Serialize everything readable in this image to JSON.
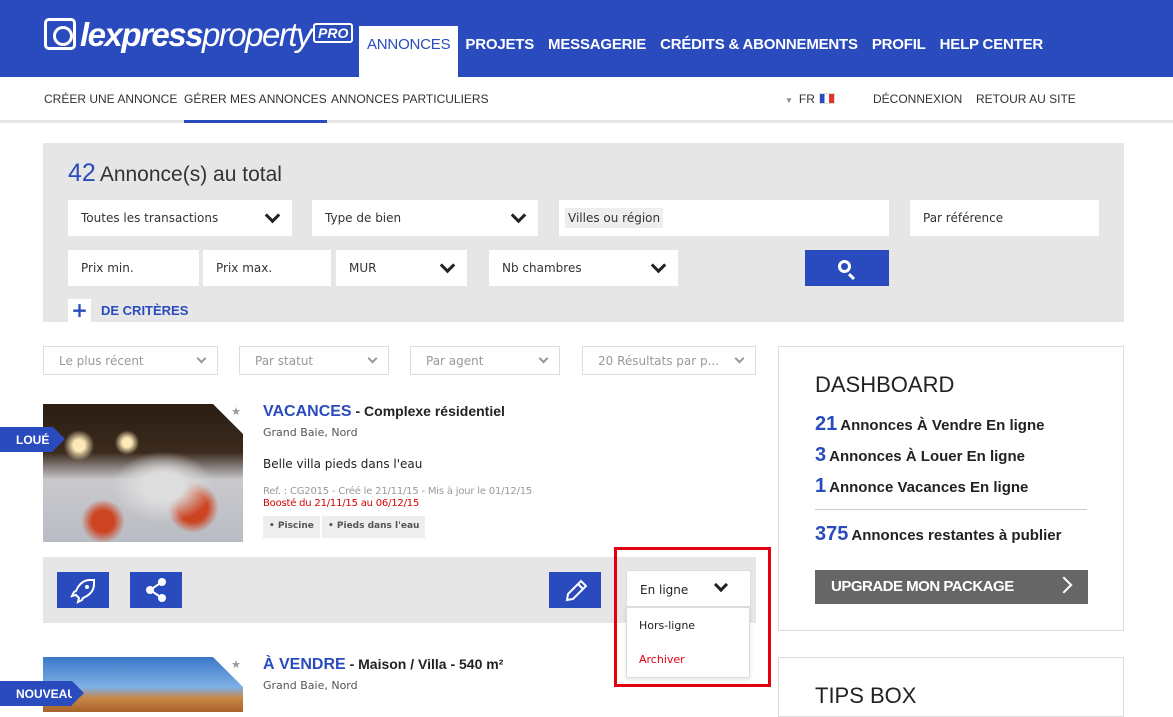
{
  "brand": {
    "name_bold": "lexpress",
    "name_light": "property",
    "badge": "PRO"
  },
  "main_nav": [
    "ANNONCES",
    "PROJETS",
    "MESSAGERIE",
    "CRÉDITS & ABONNEMENTS",
    "PROFIL",
    "HELP CENTER"
  ],
  "sub_nav": {
    "create": "CRÉER UNE ANNONCE",
    "manage": "GÉRER MES ANNONCES",
    "particuliers": "ANNONCES PARTICULIERS",
    "lang": "FR",
    "logout": "DÉCONNEXION",
    "back": "RETOUR AU SITE"
  },
  "search": {
    "total_count": "42",
    "total_label": "Annonce(s) au total",
    "transactions": "Toutes les transactions",
    "type": "Type de bien",
    "ville": "Villes ou région",
    "reference": "Par référence",
    "prix_min": "Prix min.",
    "prix_max": "Prix max.",
    "currency": "MUR",
    "chambres": "Nb chambres",
    "more_criteria": "DE CRITÈRES"
  },
  "filters": {
    "sort": "Le plus récent",
    "status": "Par statut",
    "agent": "Par agent",
    "per_page": "20 Résultats par p..."
  },
  "listings": [
    {
      "badge": "LOUÉ",
      "category": "VACANCES",
      "title": " - Complexe résidentiel",
      "location": "Grand Baie, Nord",
      "description": "Belle villa pieds dans l'eau",
      "meta": "Ref. : CG2015 - Créé le 21/11/15 - Mis à jour le 01/12/15",
      "boost": "Boosté du 21/11/15 au 06/12/15",
      "tags": [
        "• Piscine",
        "• Pieds dans l'eau"
      ],
      "status": "En ligne",
      "status_options": [
        "Hors-ligne",
        "Archiver"
      ]
    },
    {
      "badge": "NOUVEAU",
      "category": "À VENDRE",
      "title": " - Maison / Villa - 540 m²",
      "location": "Grand Baie, Nord"
    }
  ],
  "dashboard": {
    "title": "DASHBOARD",
    "rows": [
      {
        "n": "21",
        "label": "Annonces À Vendre En ligne"
      },
      {
        "n": "3",
        "label": "Annonces À Louer En ligne"
      },
      {
        "n": "1",
        "label": "Annonce Vacances En ligne"
      }
    ],
    "remaining": {
      "n": "375",
      "label": "Annonces restantes à publier"
    },
    "upgrade": "UPGRADE MON PACKAGE"
  },
  "tips": {
    "title": "TIPS BOX"
  },
  "colors": {
    "brand": "#2a4bbd",
    "archive": "#e3000f",
    "boost": "#d50000"
  }
}
